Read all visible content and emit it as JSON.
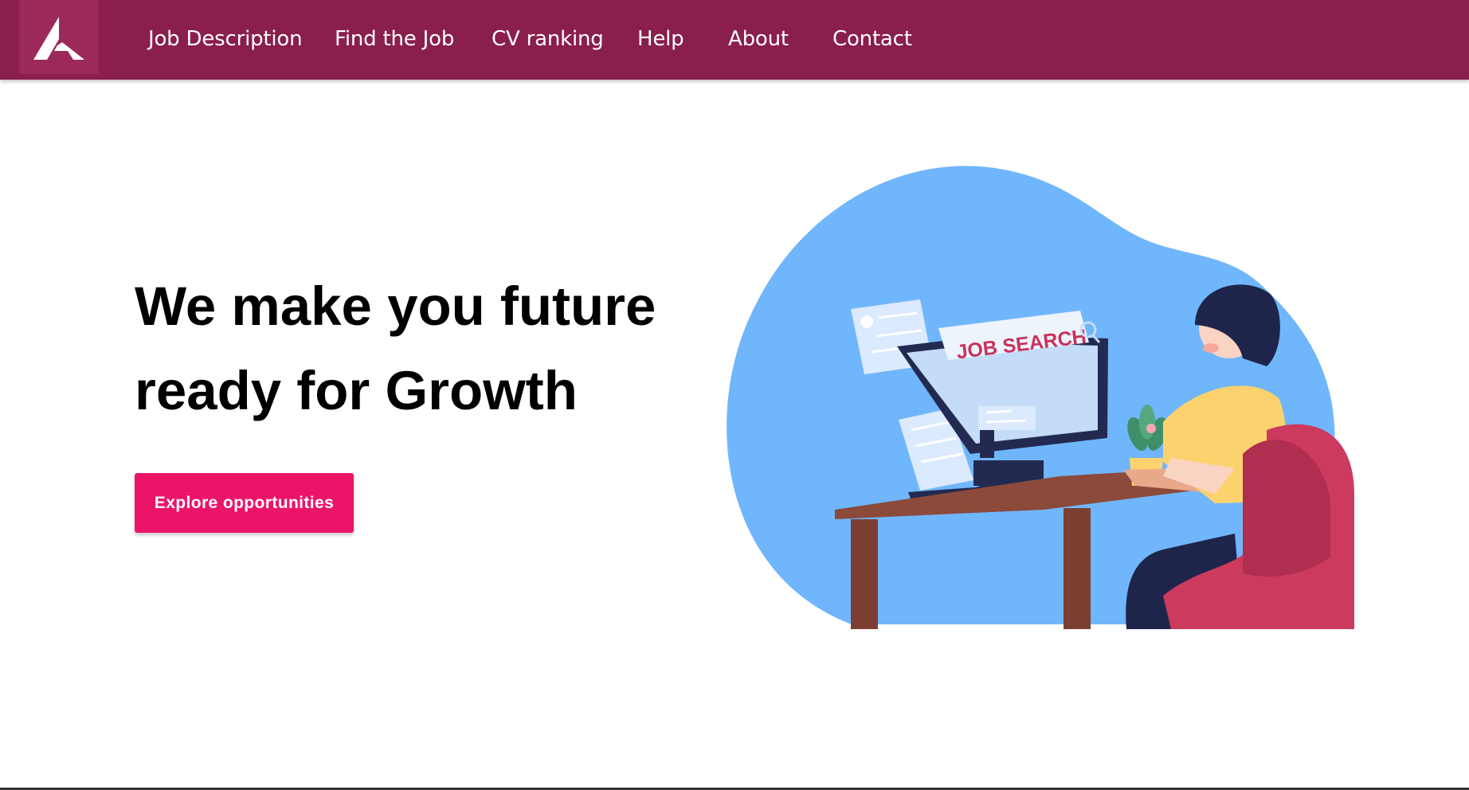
{
  "navbar": {
    "logo_icon": "axis-logo-icon",
    "links": [
      {
        "label": "Job Description"
      },
      {
        "label": "Find the Job"
      },
      {
        "label": "CV ranking"
      },
      {
        "label": "Help"
      },
      {
        "label": "About"
      },
      {
        "label": "Contact"
      }
    ]
  },
  "hero": {
    "title_line1": "We make you future",
    "title_line2": "ready for Growth",
    "cta_label": "Explore opportunities",
    "illustration": {
      "banner_text": "JOB SEARCH",
      "icons": [
        "search-icon",
        "plant-icon",
        "monitor-icon"
      ]
    }
  },
  "colors": {
    "navbar_bg": "#8a1e4c",
    "logo_bg": "#9b2a5a",
    "cta_bg": "#ec1469",
    "blob": "#70b6fc",
    "chair": "#cc3a5e",
    "shirt": "#fcd26e",
    "desk": "#8b4a3a"
  }
}
